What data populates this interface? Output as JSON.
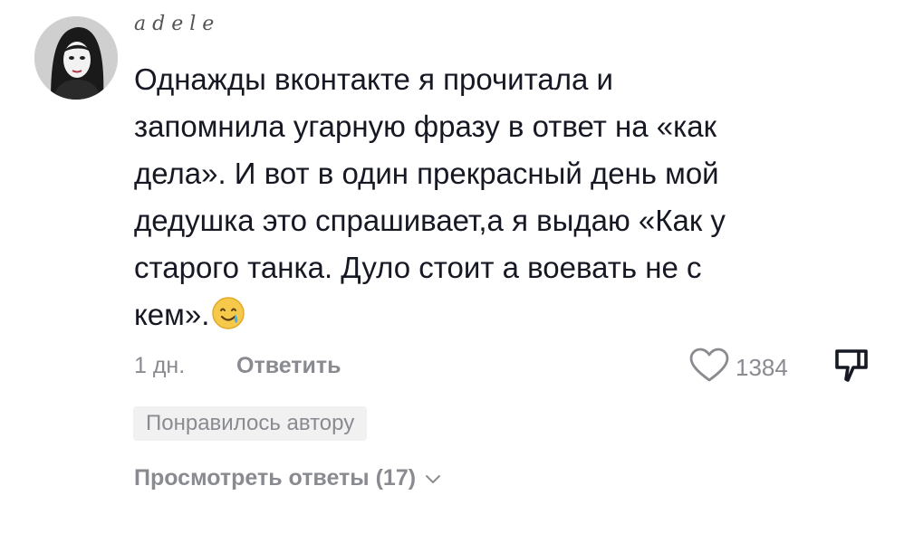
{
  "comment": {
    "username": "adele",
    "lines": [
      "Однажды вконтакте я прочитала и",
      "запомнила угарную фразу в ответ на «как",
      "дела». И вот в один прекрасный день мой",
      "дедушка это спрашивает,а я выдаю «Как у",
      "старого танка. Дуло стоит а воевать не с",
      "кем»."
    ],
    "emoji": "smiling-face-with-tear",
    "time": "1 дн.",
    "reply_label": "Ответить",
    "like_count": "1384",
    "author_liked_badge": "Понравилось автору",
    "view_replies_label": "Просмотреть ответы (17)"
  },
  "colors": {
    "text": "#161823",
    "muted": "#8a8b91",
    "badge_bg": "#f1f1f2"
  }
}
